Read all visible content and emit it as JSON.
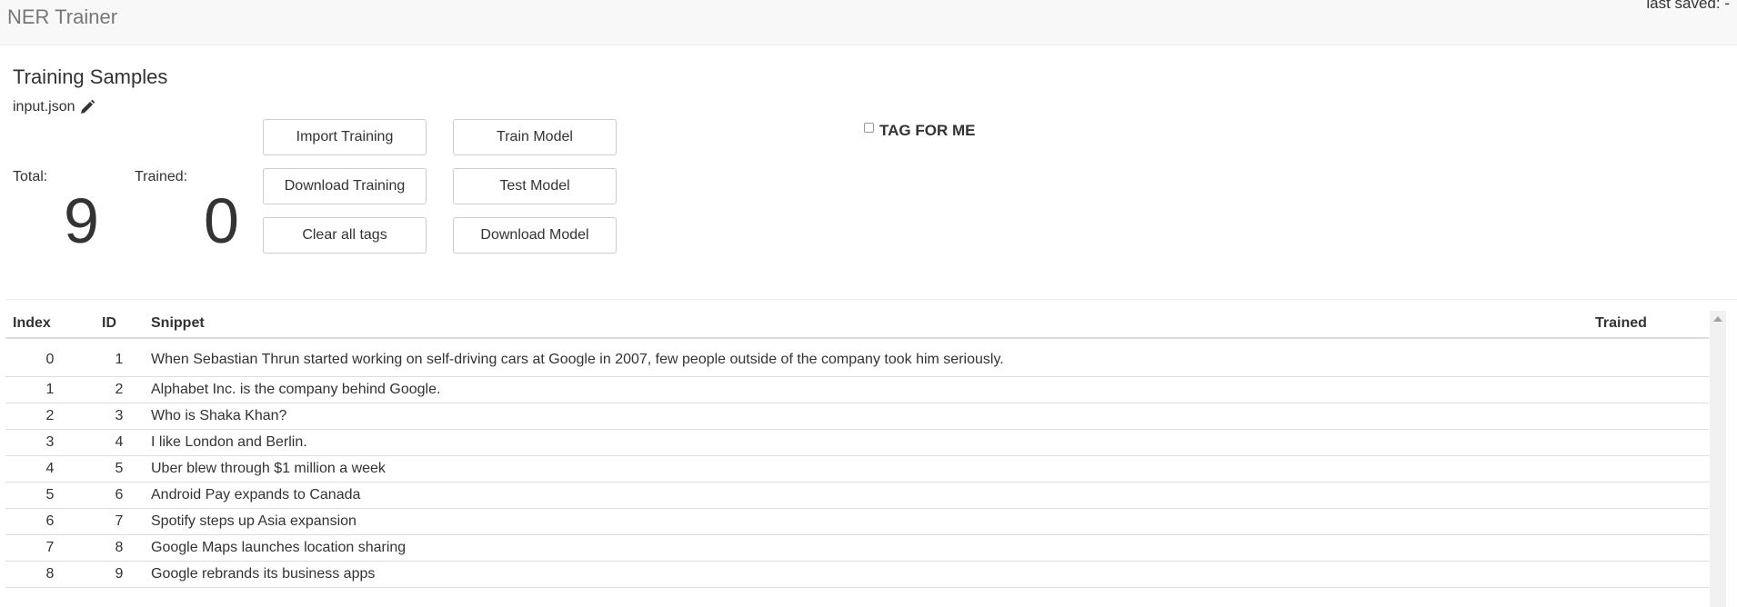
{
  "app": {
    "brand": "NER Trainer",
    "last_saved": "last saved: -"
  },
  "section": {
    "title": "Training Samples",
    "filename": "input.json",
    "edit_icon": "pencil-icon"
  },
  "stats": {
    "total_label": "Total:",
    "total_value": "9",
    "trained_label": "Trained:",
    "trained_value": "0"
  },
  "buttons": {
    "import_training": "Import Training",
    "download_training": "Download Training",
    "clear_all_tags": "Clear all tags",
    "train_model": "Train Model",
    "test_model": "Test Model",
    "download_model": "Download Model"
  },
  "tag_for_me": {
    "label": "TAG FOR ME",
    "checked": false
  },
  "table": {
    "headers": [
      "Index",
      "ID",
      "Snippet",
      "Trained"
    ],
    "rows": [
      {
        "index": "0",
        "id": "1",
        "snippet": "When Sebastian Thrun started working on self-driving cars at Google in 2007, few people outside of the company took him seriously.",
        "trained": ""
      },
      {
        "index": "1",
        "id": "2",
        "snippet": "Alphabet Inc. is the company behind Google.",
        "trained": ""
      },
      {
        "index": "2",
        "id": "3",
        "snippet": "Who is Shaka Khan?",
        "trained": ""
      },
      {
        "index": "3",
        "id": "4",
        "snippet": "I like London and Berlin.",
        "trained": ""
      },
      {
        "index": "4",
        "id": "5",
        "snippet": "Uber blew through $1 million a week",
        "trained": ""
      },
      {
        "index": "5",
        "id": "6",
        "snippet": "Android Pay expands to Canada",
        "trained": ""
      },
      {
        "index": "6",
        "id": "7",
        "snippet": "Spotify steps up Asia expansion",
        "trained": ""
      },
      {
        "index": "7",
        "id": "8",
        "snippet": "Google Maps launches location sharing",
        "trained": ""
      },
      {
        "index": "8",
        "id": "9",
        "snippet": "Google rebrands its business apps",
        "trained": ""
      }
    ]
  }
}
